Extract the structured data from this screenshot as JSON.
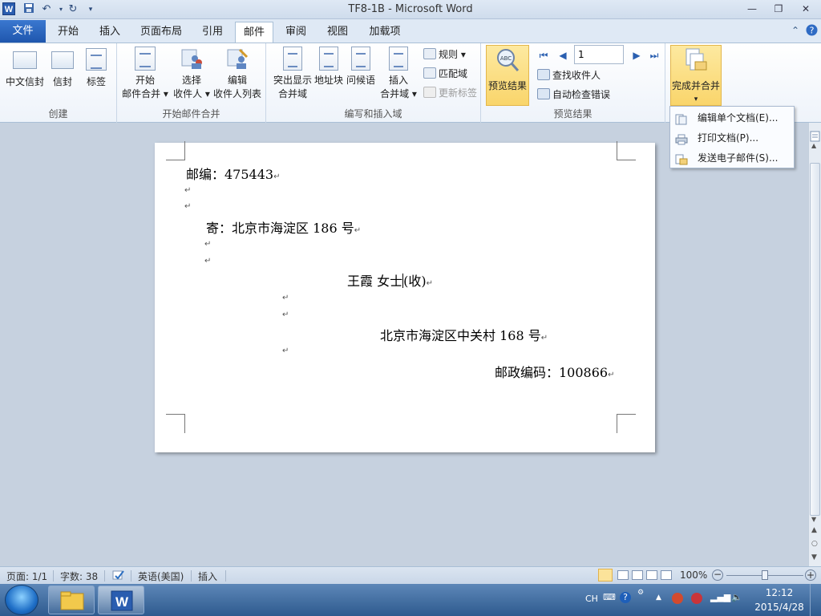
{
  "window": {
    "title": "TF8-1B  -  Microsoft Word",
    "app_icon": "W",
    "qat": [
      "save-icon",
      "undo-icon",
      "redo-icon",
      "customize-icon"
    ],
    "controls": [
      "minimize",
      "restore",
      "close"
    ]
  },
  "tabs": {
    "file": "文件",
    "items": [
      "开始",
      "插入",
      "页面布局",
      "引用",
      "邮件",
      "审阅",
      "视图",
      "加载项"
    ],
    "active": "邮件"
  },
  "ribbon": {
    "create": {
      "label": "创建",
      "chinese_envelope": "中文信封",
      "envelope": "信封",
      "labels": "标签"
    },
    "start_merge": {
      "label": "开始邮件合并",
      "start_l1": "开始",
      "start_l2": "邮件合并",
      "select_l1": "选择",
      "select_l2": "收件人",
      "edit_l1": "编辑",
      "edit_l2": "收件人列表"
    },
    "write_insert": {
      "label": "编写和插入域",
      "highlight_l1": "突出显示",
      "highlight_l2": "合并域",
      "address_block": "地址块",
      "greeting": "问候语",
      "insert_l1": "插入",
      "insert_l2": "合并域",
      "rules": "规则",
      "match_fields": "匹配域",
      "update_labels": "更新标签"
    },
    "preview": {
      "label": "预览结果",
      "preview_button": "预览结果",
      "record_value": "1",
      "find_recipient": "查找收件人",
      "auto_check": "自动检查错误"
    },
    "finish": {
      "label": "完成并合并"
    }
  },
  "dropdown": {
    "items": [
      "编辑单个文档(E)...",
      "打印文档(P)...",
      "发送电子邮件(S)..."
    ]
  },
  "document": {
    "postcode_line": "邮编：475443",
    "sender_line": "寄：北京市海淀区 186 号",
    "recipient_name": "王霞    女士",
    "recipient_suffix": "(收)",
    "recipient_address": "北京市海淀区中关村 168 号",
    "recipient_postcode": "邮政编码：100866",
    "para_mark": "↵"
  },
  "statusbar": {
    "page": "页面: 1/1",
    "words": "字数: 38",
    "language": "英语(美国)",
    "mode": "插入",
    "zoom": "100%"
  },
  "taskbar": {
    "lang": "CH",
    "time": "12:12",
    "date": "2015/4/28"
  }
}
